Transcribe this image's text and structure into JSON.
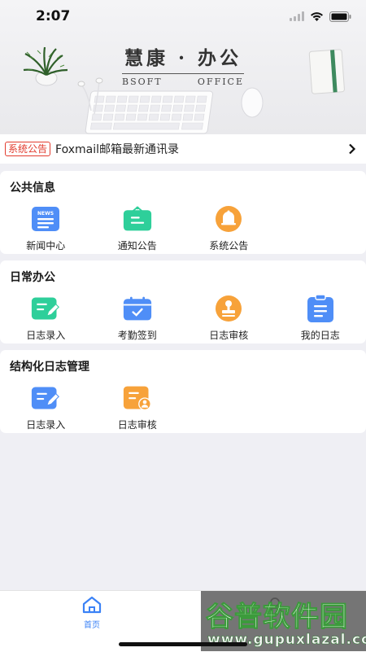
{
  "status_bar": {
    "time": "2:07"
  },
  "banner": {
    "title": "慧康 · 办公",
    "subtitle_left": "BSOFT",
    "subtitle_right": "OFFICE"
  },
  "notice": {
    "tag": "系统公告",
    "text": "Foxmail邮箱最新通讯录"
  },
  "sections": [
    {
      "title": "公共信息",
      "items": [
        {
          "label": "新闻中心",
          "icon": "news-icon",
          "color": "#4f8ef7"
        },
        {
          "label": "通知公告",
          "icon": "notice-board-icon",
          "color": "#2ecf9a"
        },
        {
          "label": "系统公告",
          "icon": "bell-icon",
          "color": "#f7a23a"
        }
      ]
    },
    {
      "title": "日常办公",
      "items": [
        {
          "label": "日志录入",
          "icon": "log-entry-icon",
          "color": "#2ecf9a"
        },
        {
          "label": "考勤签到",
          "icon": "calendar-check-icon",
          "color": "#4f8ef7"
        },
        {
          "label": "日志审核",
          "icon": "stamp-icon",
          "color": "#f7a23a"
        },
        {
          "label": "我的日志",
          "icon": "clipboard-icon",
          "color": "#4f8ef7"
        }
      ]
    },
    {
      "title": "结构化日志管理",
      "items": [
        {
          "label": "日志录入",
          "icon": "log-entry-icon",
          "color": "#4f8ef7"
        },
        {
          "label": "日志审核",
          "icon": "user-document-icon",
          "color": "#f7a23a"
        }
      ]
    }
  ],
  "tabbar": {
    "home_label": "首页",
    "active_color": "#3b82f6"
  },
  "watermark": {
    "main": "谷普软件园",
    "url": "www.gupuxlazal.com"
  }
}
